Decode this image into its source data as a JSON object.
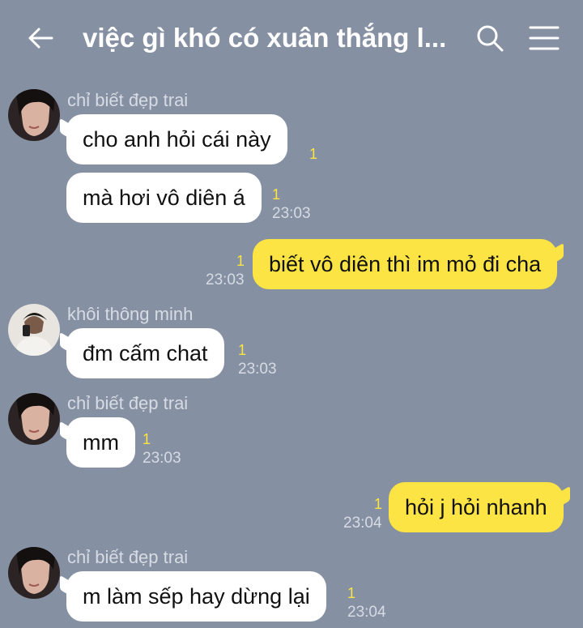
{
  "header": {
    "title": "việc gì khó có xuân thắng l...",
    "icons": [
      "back-arrow-icon",
      "search-icon",
      "menu-icon"
    ]
  },
  "colors": {
    "background": "#8690a3",
    "my_bubble": "#fbe443",
    "other_bubble": "#ffffff",
    "unread_count": "#fbe443"
  },
  "messages": [
    {
      "sender": "chỉ biết đẹp trai",
      "text": "cho anh hỏi cái này",
      "unread": "1",
      "time": ""
    },
    {
      "sender": "",
      "text": "mà hơi vô diên á",
      "unread": "1",
      "time": "23:03"
    },
    {
      "sender": "me",
      "text": "biết vô diên thì im mỏ đi cha",
      "unread": "1",
      "time": "23:03"
    },
    {
      "sender": "khôi thông minh",
      "text": "đm cấm chat",
      "unread": "1",
      "time": "23:03"
    },
    {
      "sender": "chỉ biết đẹp trai",
      "text": "mm",
      "unread": "1",
      "time": "23:03"
    },
    {
      "sender": "me",
      "text": "hỏi j hỏi nhanh",
      "unread": "1",
      "time": "23:04"
    },
    {
      "sender": "chỉ biết đẹp trai",
      "text": "m làm sếp hay dừng lại",
      "unread": "1",
      "time": "23:04"
    }
  ]
}
